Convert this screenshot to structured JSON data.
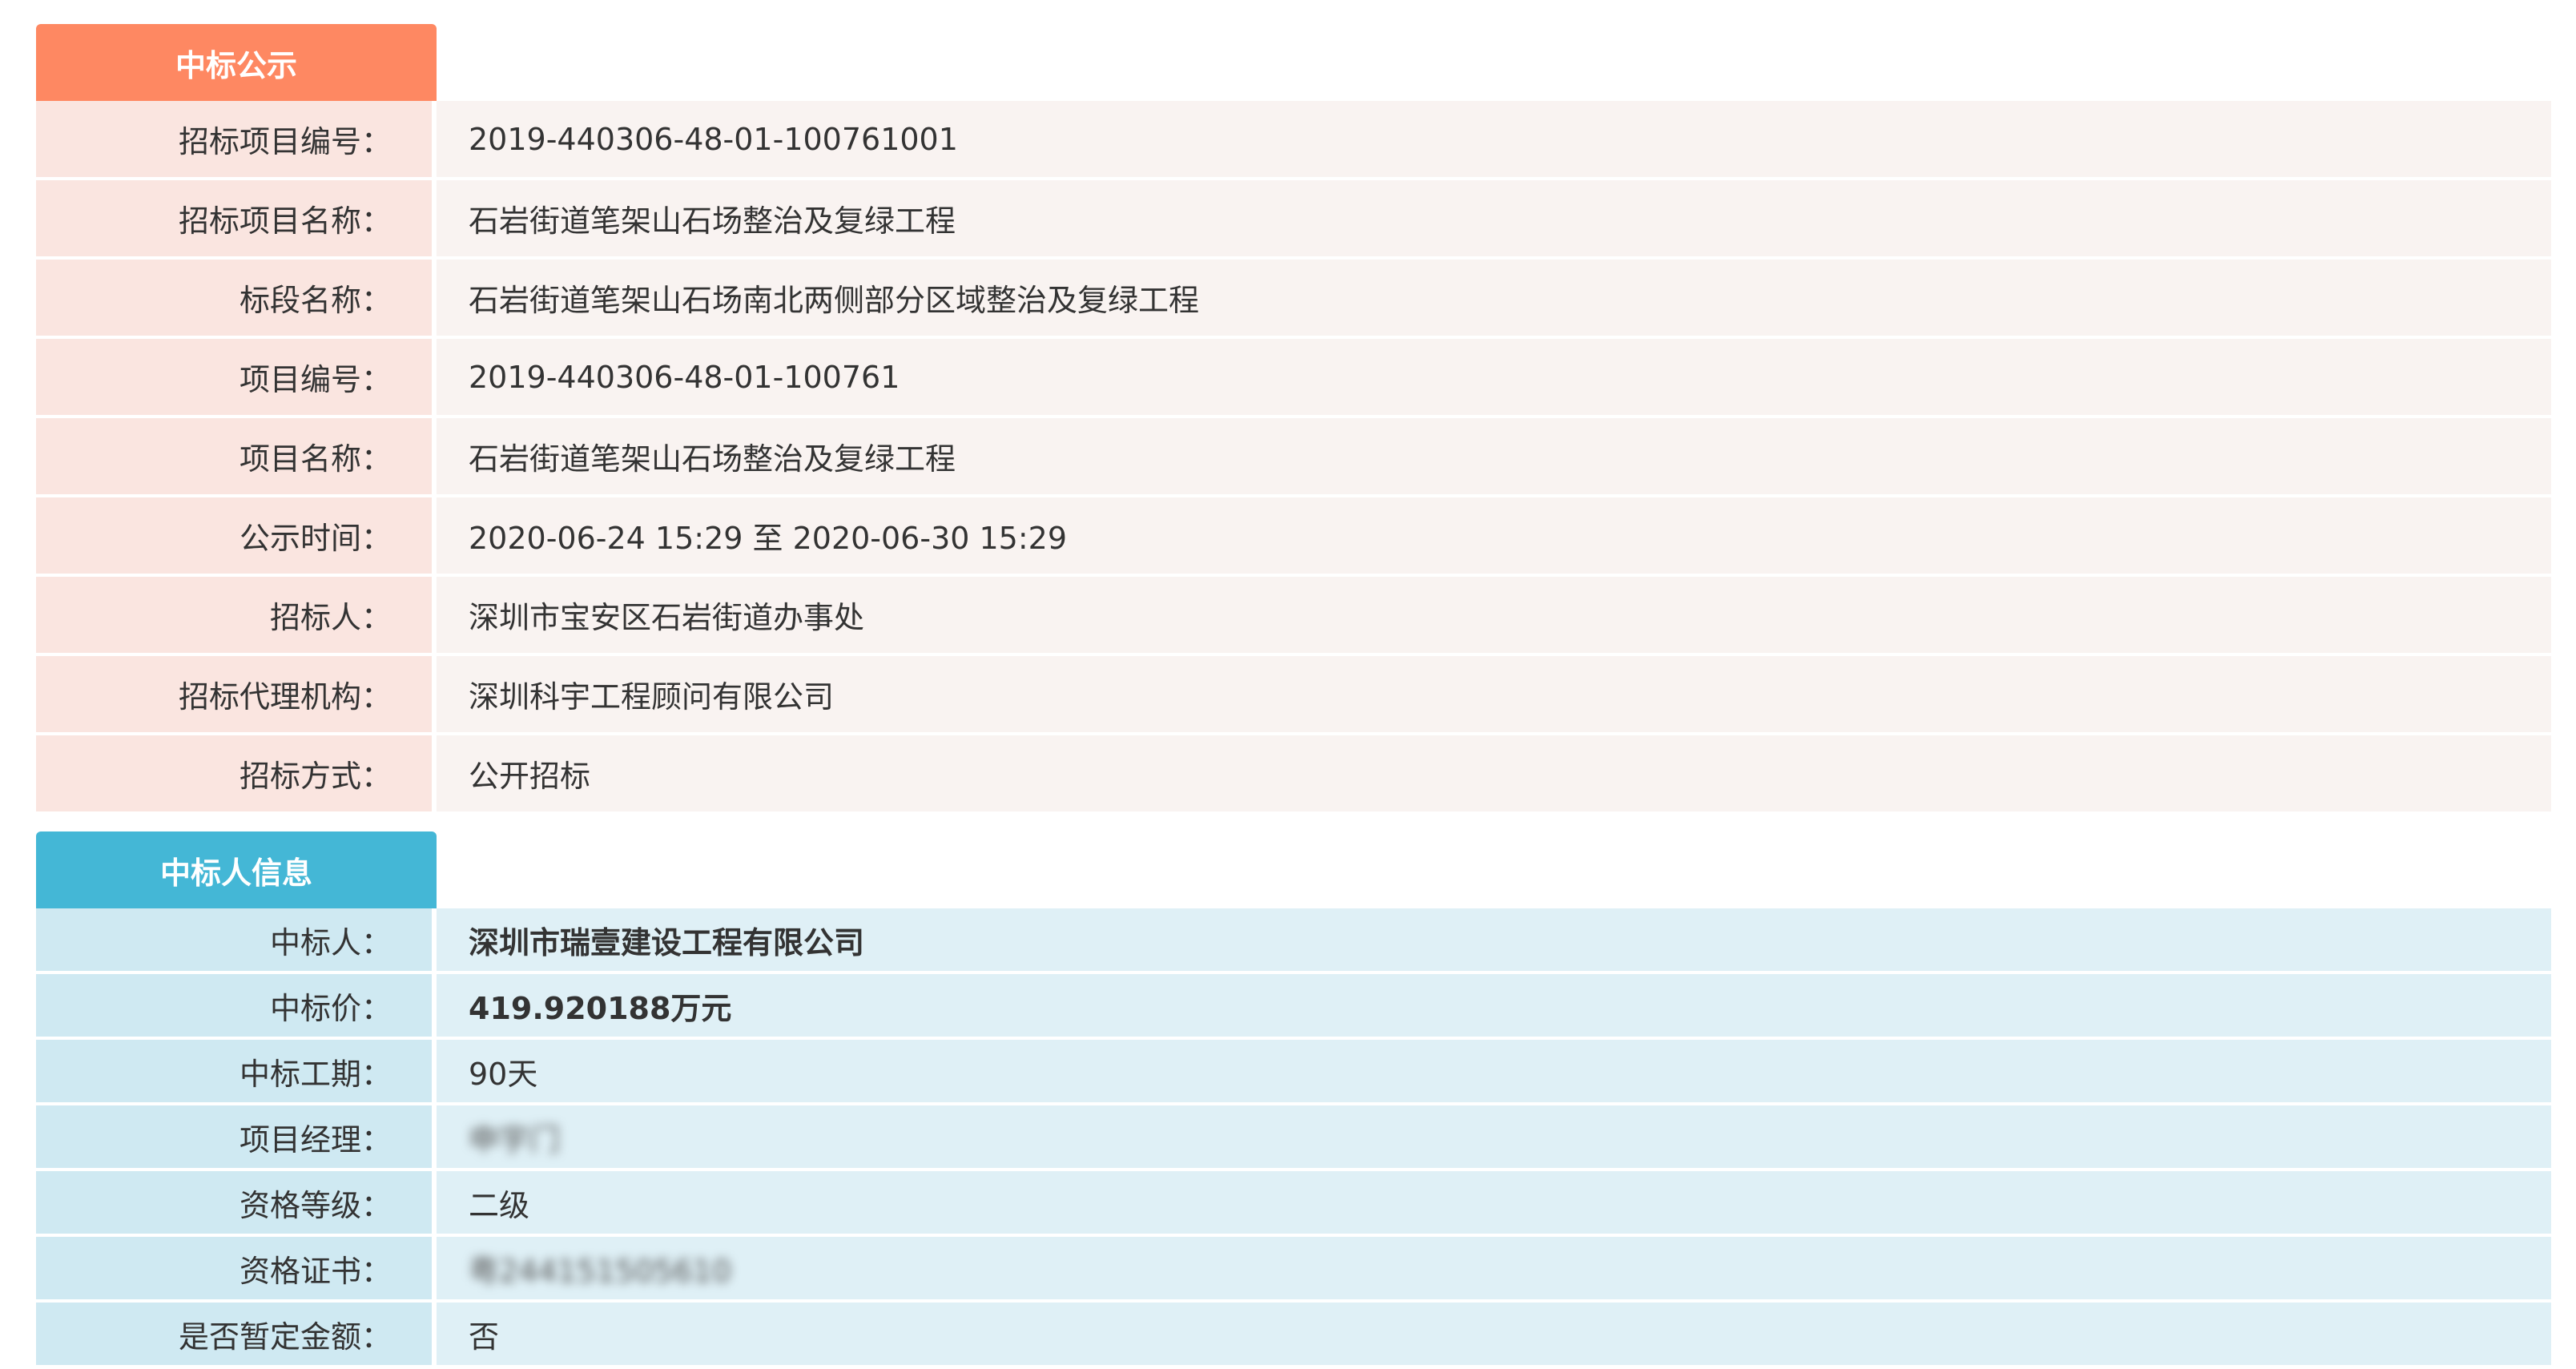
{
  "section1": {
    "title": "中标公示",
    "rows": [
      {
        "label": "招标项目编号：",
        "value": "2019-440306-48-01-100761001"
      },
      {
        "label": "招标项目名称：",
        "value": "石岩街道笔架山石场整治及复绿工程"
      },
      {
        "label": "标段名称：",
        "value": "石岩街道笔架山石场南北两侧部分区域整治及复绿工程"
      },
      {
        "label": "项目编号：",
        "value": "2019-440306-48-01-100761"
      },
      {
        "label": "项目名称：",
        "value": "石岩街道笔架山石场整治及复绿工程"
      },
      {
        "label": "公示时间：",
        "value": "2020-06-24 15:29 至 2020-06-30 15:29"
      },
      {
        "label": "招标人：",
        "value": "深圳市宝安区石岩街道办事处"
      },
      {
        "label": "招标代理机构：",
        "value": "深圳科宇工程顾问有限公司"
      },
      {
        "label": "招标方式：",
        "value": "公开招标"
      }
    ]
  },
  "section2": {
    "title": "中标人信息",
    "rows": [
      {
        "label": "中标人：",
        "value": "深圳市瑞壹建设工程有限公司"
      },
      {
        "label": "中标价：",
        "value": "419.920188万元"
      },
      {
        "label": "中标工期：",
        "value": "90天"
      },
      {
        "label": "项目经理：",
        "value": "申宇门"
      },
      {
        "label": "资格等级：",
        "value": "二级"
      },
      {
        "label": "资格证书：",
        "value": "粤244151505610"
      },
      {
        "label": "是否暂定金额：",
        "value": "否"
      }
    ]
  }
}
